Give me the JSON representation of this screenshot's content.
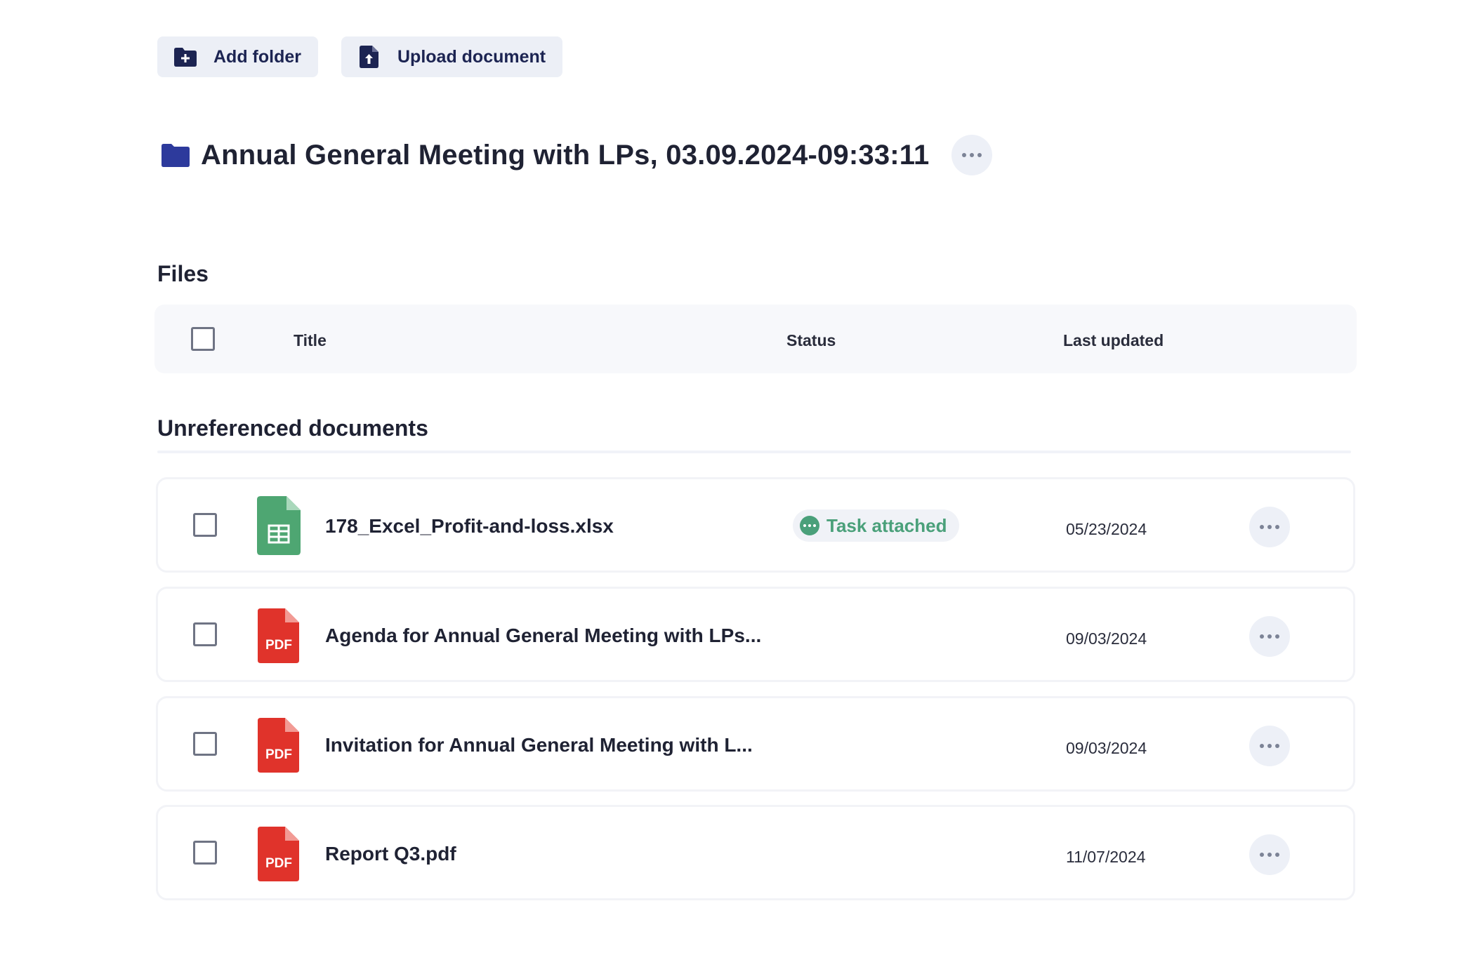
{
  "toolbar": {
    "add_folder_label": "Add folder",
    "upload_document_label": "Upload document"
  },
  "folder": {
    "title": "Annual General Meeting with LPs, 03.09.2024-09:33:11"
  },
  "files": {
    "heading": "Files",
    "columns": {
      "title": "Title",
      "status": "Status",
      "last_updated": "Last updated"
    }
  },
  "unreferenced": {
    "heading": "Unreferenced documents",
    "documents": [
      {
        "title": "178_Excel_Profit-and-loss.xlsx",
        "type": "xlsx",
        "icon": "spreadsheet-file-icon",
        "status": "Task attached",
        "last_updated": "05/23/2024"
      },
      {
        "title": "Agenda for Annual General Meeting with LPs...",
        "type": "pdf",
        "icon": "pdf-file-icon",
        "icon_label": "PDF",
        "status": "",
        "last_updated": "09/03/2024"
      },
      {
        "title": "Invitation for Annual General Meeting with L...",
        "type": "pdf",
        "icon": "pdf-file-icon",
        "icon_label": "PDF",
        "status": "",
        "last_updated": "09/03/2024"
      },
      {
        "title": "Report Q3.pdf",
        "type": "pdf",
        "icon": "pdf-file-icon",
        "icon_label": "PDF",
        "status": "",
        "last_updated": "11/07/2024"
      }
    ]
  },
  "colors": {
    "accent": "#1c2452",
    "folder_blue": "#2d3a9c",
    "status_green": "#4aa07a",
    "pdf_red": "#e0332b",
    "xlsx_green": "#4ea672"
  }
}
